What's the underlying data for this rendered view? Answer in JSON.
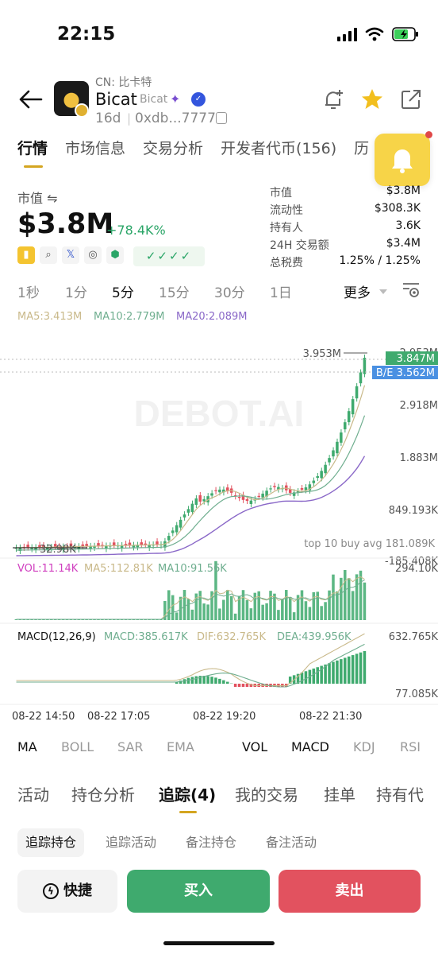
{
  "status_bar": {
    "time": "22:15"
  },
  "header": {
    "cn_name": "CN: 比卡特",
    "token_name": "Bicat",
    "token_sub": "Bicat",
    "age": "16d",
    "address": "0xdb...7777"
  },
  "top_tabs": [
    "行情",
    "市场信息",
    "交易分析",
    "开发者代币(156)",
    "历"
  ],
  "market": {
    "mc_label": "市值 ⇋",
    "mc_value": "$3.8M",
    "mc_change": "+78.4K%",
    "stats": [
      {
        "label": "市值",
        "value": "$3.8M"
      },
      {
        "label": "流动性",
        "value": "$308.3K"
      },
      {
        "label": "持有人",
        "value": "3.6K"
      },
      {
        "label": "24H 交易额",
        "value": "$3.4M"
      },
      {
        "label": "总税费",
        "value": "1.25% / 1.25%"
      }
    ],
    "checks": "✓✓✓✓"
  },
  "intervals": [
    "1秒",
    "1分",
    "5分",
    "15分",
    "30分",
    "1日"
  ],
  "interval_more": "更多",
  "chart": {
    "watermark": "DEBOT.AI",
    "ma_labels": [
      "MA5:3.413M",
      "MA10:2.779M",
      "MA20:2.089M"
    ],
    "price_axis": [
      "2.953M",
      "2.918M",
      "1.883M",
      "849.193K",
      "-185.408K"
    ],
    "high_label": "3.953M",
    "last_price": "3.847M",
    "be_label": "B/E 3.562M",
    "low_label": "32.98K",
    "top10": "top 10 buy avg 181.089K",
    "vol_labels": [
      "VOL:11.14K",
      "MA5:112.81K",
      "MA10:91.56K"
    ],
    "vol_axis": "294.10K",
    "macd_labels": [
      "MACD(12,26,9)",
      "MACD:385.617K",
      "DIF:632.765K",
      "DEA:439.956K"
    ],
    "macd_axis": [
      "632.765K",
      "77.085K"
    ],
    "time_axis": [
      "08-22 14:50",
      "08-22 17:05",
      "08-22 19:20",
      "08-22 21:30"
    ],
    "colors": {
      "up": "#3faa6e",
      "down": "#e2525f",
      "ma5": "#c9b98a",
      "ma10": "#6fae8f",
      "ma20": "#8a68c8"
    }
  },
  "indicator_tabs": [
    "MA",
    "BOLL",
    "SAR",
    "EMA",
    "VOL",
    "MACD",
    "KDJ",
    "RSI"
  ],
  "bottom_tabs": [
    "活动",
    "持仓分析",
    "追踪(4)",
    "我的交易",
    "挂单",
    "持有代"
  ],
  "sub_tabs": [
    "追踪持仓",
    "追踪活动",
    "备注持仓",
    "备注活动"
  ],
  "buttons": {
    "quick": "快捷",
    "buy": "买入",
    "sell": "卖出"
  }
}
